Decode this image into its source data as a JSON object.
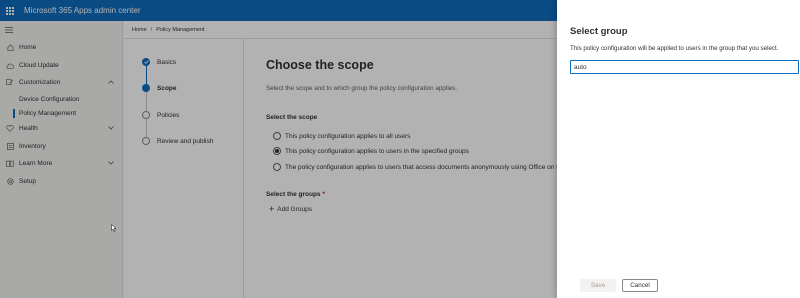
{
  "app": {
    "title": "Microsoft 365 Apps admin center",
    "waffle_icon": "waffle-icon"
  },
  "nav": {
    "hamburger_icon": "hamburger-icon",
    "items": [
      {
        "label": "Home",
        "icon": "home-icon"
      },
      {
        "label": "Cloud Update",
        "icon": "cloud-icon"
      },
      {
        "label": "Customization",
        "icon": "pen-icon",
        "expanded": true
      },
      {
        "label": "Health",
        "icon": "heart-icon"
      },
      {
        "label": "Inventory",
        "icon": "inventory-icon"
      },
      {
        "label": "Learn More",
        "icon": "book-icon"
      },
      {
        "label": "Setup",
        "icon": "gear-icon"
      }
    ],
    "subitems": [
      {
        "label": "Device Configuration"
      },
      {
        "label": "Policy Management",
        "active": true
      }
    ]
  },
  "breadcrumb": {
    "home": "Home",
    "sep": "/",
    "current": "Policy Management"
  },
  "wizard": {
    "steps": [
      {
        "label": "Basics",
        "state": "done"
      },
      {
        "label": "Scope",
        "state": "current"
      },
      {
        "label": "Policies",
        "state": "pending"
      },
      {
        "label": "Review and publish",
        "state": "pending"
      }
    ],
    "heading": "Choose the scope",
    "description": "Select the scope and to which group the policy configuration applies.",
    "scope_label": "Select the scope",
    "scope_options": [
      {
        "label": "This policy configuration applies to all users",
        "checked": false
      },
      {
        "label": "This policy configuration applies to users in the specified groups",
        "checked": true
      },
      {
        "label": "The policy configuration applies to users that access documents anonymously using Office on the web",
        "checked": false
      }
    ],
    "groups_label": "Select the groups",
    "required_mark": "*",
    "add_groups": "Add Groups"
  },
  "panel": {
    "title": "Select group",
    "description": "This policy configuration will be applied to users in the group that you select.",
    "search_value": "auto",
    "save_label": "Save",
    "cancel_label": "Cancel"
  },
  "colors": {
    "brand": "#0f6cbd",
    "overlay": "rgba(0,0,0,0.30)"
  }
}
